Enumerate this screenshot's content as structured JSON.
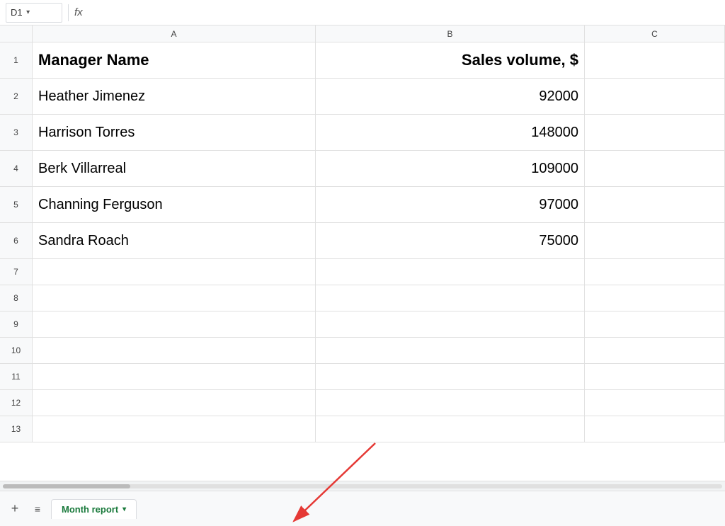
{
  "formulaBar": {
    "cellRef": "D1",
    "dropdownIcon": "▾",
    "fxLabel": "fx",
    "formula": ""
  },
  "columns": {
    "headers": [
      "A",
      "B",
      "C"
    ],
    "selectedCol": "D"
  },
  "rows": [
    {
      "rowNum": "1",
      "colA": "Manager Name",
      "colB": "Sales volume, $",
      "isHeader": true
    },
    {
      "rowNum": "2",
      "colA": "Heather Jimenez",
      "colB": "92000"
    },
    {
      "rowNum": "3",
      "colA": "Harrison Torres",
      "colB": "148000"
    },
    {
      "rowNum": "4",
      "colA": "Berk Villarreal",
      "colB": "109000"
    },
    {
      "rowNum": "5",
      "colA": "Channing Ferguson",
      "colB": "97000"
    },
    {
      "rowNum": "6",
      "colA": "Sandra Roach",
      "colB": "75000"
    }
  ],
  "emptyRows": [
    "7",
    "8",
    "9",
    "10",
    "11",
    "12",
    "13"
  ],
  "sheetTabs": {
    "addIcon": "+",
    "listIcon": "≡",
    "activeTab": {
      "label": "Month report",
      "dropdownIcon": "▾"
    }
  }
}
